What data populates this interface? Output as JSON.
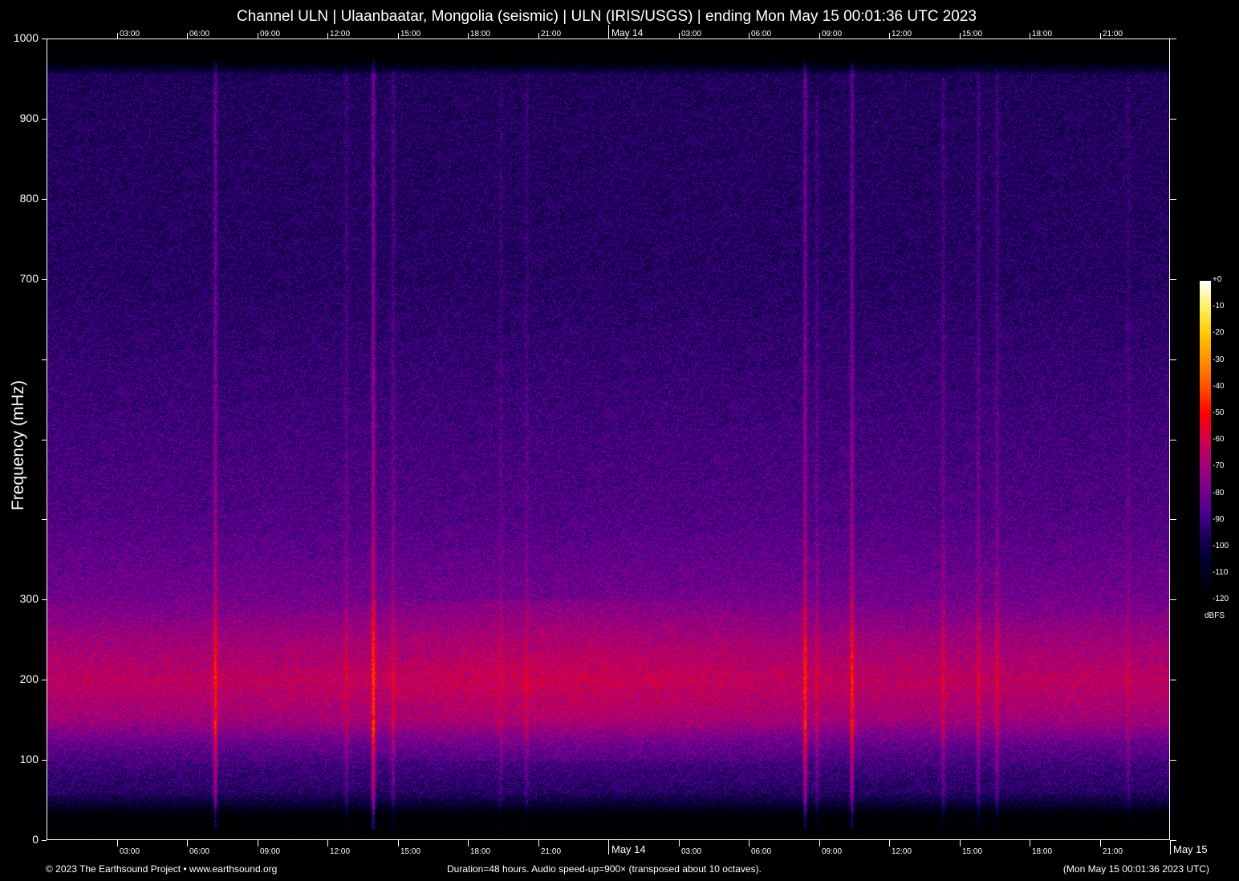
{
  "chart_data": {
    "type": "heatmap",
    "title": "Channel ULN | Ulaanbaatar, Mongolia (seismic) | ULN (IRIS/USGS) | ending Mon May 15 00:01:36 UTC 2023",
    "ylabel": "Frequency (mHz)",
    "xlabel": "",
    "ylim": [
      0,
      1000
    ],
    "xlim_hours": [
      0,
      48
    ],
    "y_ticks": [
      {
        "value": 1000,
        "label": "1000"
      },
      {
        "value": 900,
        "label": "900"
      },
      {
        "value": 800,
        "label": "800"
      },
      {
        "value": 700,
        "label": "700"
      },
      {
        "value": 600,
        "label": ""
      },
      {
        "value": 500,
        "label": ""
      },
      {
        "value": 400,
        "label": ""
      },
      {
        "value": 300,
        "label": "300"
      },
      {
        "value": 200,
        "label": "200"
      },
      {
        "value": 100,
        "label": "100"
      },
      {
        "value": 0,
        "label": "0"
      }
    ],
    "x_ticks": [
      {
        "hour": 3,
        "label": "03:00"
      },
      {
        "hour": 6,
        "label": "06:00"
      },
      {
        "hour": 9,
        "label": "09:00"
      },
      {
        "hour": 12,
        "label": "12:00"
      },
      {
        "hour": 15,
        "label": "15:00"
      },
      {
        "hour": 18,
        "label": "18:00"
      },
      {
        "hour": 21,
        "label": "21:00"
      },
      {
        "hour": 24,
        "label": "May 14",
        "major": true
      },
      {
        "hour": 27,
        "label": "03:00"
      },
      {
        "hour": 30,
        "label": "06:00"
      },
      {
        "hour": 33,
        "label": "09:00"
      },
      {
        "hour": 36,
        "label": "12:00"
      },
      {
        "hour": 39,
        "label": "15:00"
      },
      {
        "hour": 42,
        "label": "18:00"
      },
      {
        "hour": 45,
        "label": "21:00"
      }
    ],
    "end_label": "May 15",
    "colorbar": {
      "unit": "dBFS",
      "range": [
        -120,
        0
      ],
      "ticks": [
        "+0",
        "-10",
        "-20",
        "-30",
        "-40",
        "-50",
        "-60",
        "-70",
        "-80",
        "-90",
        "-100",
        "-110",
        "-120"
      ],
      "stops": [
        [
          -120,
          "#000000"
        ],
        [
          -105,
          "#000030"
        ],
        [
          -95,
          "#200060"
        ],
        [
          -88,
          "#480090"
        ],
        [
          -80,
          "#700090"
        ],
        [
          -70,
          "#a00080"
        ],
        [
          -60,
          "#d00050"
        ],
        [
          -50,
          "#ff0000"
        ],
        [
          -40,
          "#ff5000"
        ],
        [
          -30,
          "#ff9000"
        ],
        [
          -20,
          "#ffc800"
        ],
        [
          -10,
          "#fff060"
        ],
        [
          0,
          "#ffffff"
        ]
      ]
    },
    "background_profile_db": [
      [
        0,
        -125
      ],
      [
        30,
        -122
      ],
      [
        45,
        -105
      ],
      [
        60,
        -95
      ],
      [
        90,
        -90
      ],
      [
        120,
        -82
      ],
      [
        150,
        -70
      ],
      [
        200,
        -64
      ],
      [
        250,
        -70
      ],
      [
        300,
        -79
      ],
      [
        400,
        -86
      ],
      [
        500,
        -89
      ],
      [
        700,
        -95
      ],
      [
        900,
        -96
      ],
      [
        955,
        -97
      ],
      [
        975,
        -125
      ],
      [
        1000,
        -125
      ]
    ],
    "events": [
      {
        "hour": 7.2,
        "strength": 24,
        "top": 975
      },
      {
        "hour": 12.8,
        "strength": 10,
        "top": 960
      },
      {
        "hour": 13.95,
        "strength": 30,
        "top": 975
      },
      {
        "hour": 14.8,
        "strength": 12,
        "top": 960
      },
      {
        "hour": 19.4,
        "strength": 7,
        "top": 950
      },
      {
        "hour": 20.5,
        "strength": 8,
        "top": 960
      },
      {
        "hour": 32.4,
        "strength": 26,
        "top": 975
      },
      {
        "hour": 32.9,
        "strength": 10,
        "top": 930
      },
      {
        "hour": 34.4,
        "strength": 24,
        "top": 970
      },
      {
        "hour": 38.3,
        "strength": 12,
        "top": 950
      },
      {
        "hour": 39.8,
        "strength": 12,
        "top": 960
      },
      {
        "hour": 40.6,
        "strength": 12,
        "top": 960
      },
      {
        "hour": 46.2,
        "strength": 7,
        "top": 950
      }
    ]
  },
  "footer": {
    "copyright": "© 2023 The Earthsound Project • www.earthsound.org",
    "duration": "Duration=48 hours. Audio speed-up=900× (transposed about 10 octaves).",
    "timestamp": "(Mon May 15 00:01:36 2023 UTC)"
  }
}
